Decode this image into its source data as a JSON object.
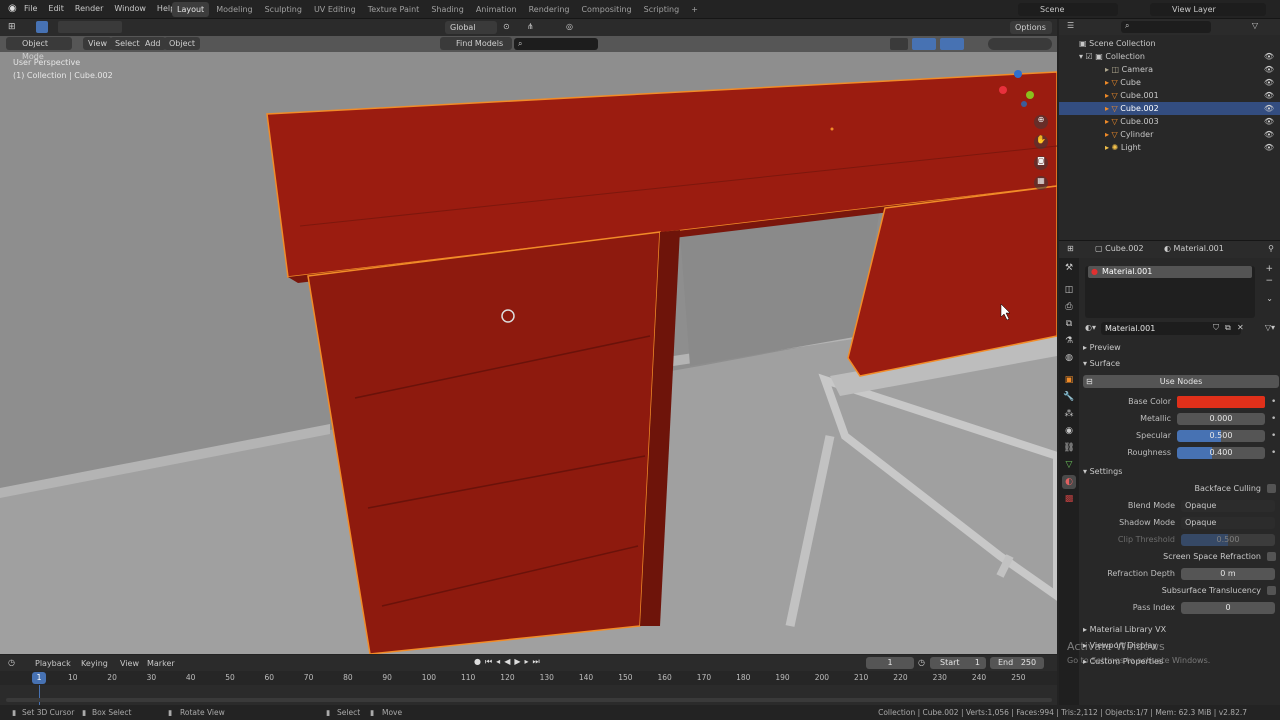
{
  "menu": [
    "File",
    "Edit",
    "Render",
    "Window",
    "Help"
  ],
  "workspaces": [
    "Layout",
    "Modeling",
    "Sculpting",
    "UV Editing",
    "Texture Paint",
    "Shading",
    "Animation",
    "Rendering",
    "Compositing",
    "Scripting"
  ],
  "add_ws": "+",
  "scene": "Scene",
  "view_layer": "View Layer",
  "toolbar": {
    "mode": "Object Mode",
    "view": "View",
    "select": "Select",
    "add": "Add",
    "object": "Object",
    "transform": "Global",
    "find": "Find Models",
    "options": "Options"
  },
  "viewport": {
    "perspective": "User Perspective",
    "collection": "(1) Collection | Cube.002"
  },
  "outliner": {
    "root": "Scene Collection",
    "collection": "Collection",
    "items": [
      "Camera",
      "Cube",
      "Cube.001",
      "Cube.002",
      "Cube.003",
      "Cylinder",
      "Light"
    ]
  },
  "properties": {
    "object": "Cube.002",
    "material": "Material.001",
    "slot": "Material.001",
    "datablock": "Material.001",
    "preview": "Preview",
    "surface": "Surface",
    "use_nodes": "Use Nodes",
    "base_color_label": "Base Color",
    "base_color": "#e0301a",
    "metallic_label": "Metallic",
    "metallic": "0.000",
    "specular_label": "Specular",
    "specular": "0.500",
    "roughness_label": "Roughness",
    "roughness": "0.400",
    "settings": "Settings",
    "backface": "Backface Culling",
    "blend_label": "Blend Mode",
    "blend": "Opaque",
    "shadow_label": "Shadow Mode",
    "shadow": "Opaque",
    "clip_label": "Clip Threshold",
    "clip": "0.500",
    "ssr": "Screen Space Refraction",
    "refr_label": "Refraction Depth",
    "refr": "0 m",
    "sss": "Subsurface Translucency",
    "pass_label": "Pass Index",
    "pass": "0",
    "lib": "Material Library VX",
    "vp_display": "Viewport Display",
    "custom": "Custom Properties",
    "watermark1": "Activate Windows",
    "watermark2": "Go to Settings to activate Windows."
  },
  "timeline": {
    "playback": "Playback",
    "keying": "Keying",
    "view": "View",
    "marker": "Marker",
    "frame": "1",
    "start_label": "Start",
    "start": "1",
    "end_label": "End",
    "end": "250",
    "current": "1",
    "ticks": [
      "10",
      "20",
      "30",
      "40",
      "50",
      "60",
      "70",
      "80",
      "90",
      "100",
      "110",
      "120",
      "130",
      "140",
      "150",
      "160",
      "170",
      "180",
      "190",
      "200",
      "210",
      "220",
      "230",
      "240",
      "250"
    ]
  },
  "status": {
    "cursor": "Set 3D Cursor",
    "box": "Box Select",
    "rotate": "Rotate View",
    "select": "Select",
    "move": "Move",
    "info": "Collection | Cube.002 | Verts:1,056 | Faces:994 | Tris:2,112 | Objects:1/7 | Mem: 62.3 MiB | v2.82.7"
  },
  "colors": {
    "object": "#9b1c10",
    "selected": "#f28c28",
    "accent": "#4772b3"
  }
}
